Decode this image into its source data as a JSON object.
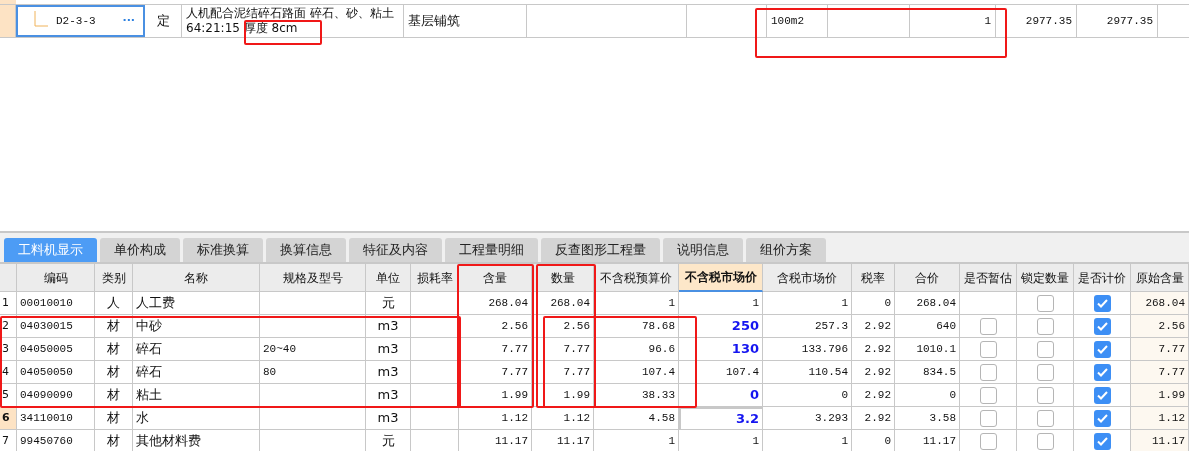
{
  "item_row": {
    "code": "D2-3-3",
    "more": "···",
    "type": "定",
    "name": "人机配合泥结碎石路面 碎石、砂、粘土64:21:15 厚度 8cm",
    "feature": "基层铺筑",
    "unit": "100m2",
    "quantity": "1",
    "unit_price": "2977.35",
    "total": "2977.35"
  },
  "tabs": [
    {
      "label": "工料机显示",
      "selected": true
    },
    {
      "label": "单价构成",
      "selected": false
    },
    {
      "label": "标准换算",
      "selected": false
    },
    {
      "label": "换算信息",
      "selected": false
    },
    {
      "label": "特征及内容",
      "selected": false
    },
    {
      "label": "工程量明细",
      "selected": false
    },
    {
      "label": "反查图形工程量",
      "selected": false
    },
    {
      "label": "说明信息",
      "selected": false
    },
    {
      "label": "组价方案",
      "selected": false
    }
  ],
  "columns": [
    "编码",
    "类别",
    "名称",
    "规格及型号",
    "单位",
    "损耗率",
    "含量",
    "数量",
    "不含税预算价",
    "不含税市场价",
    "含税市场价",
    "税率",
    "合价",
    "是否暂估",
    "锁定数量",
    "是否计价",
    "原始含量"
  ],
  "rows": [
    {
      "no": "1",
      "code": "00010010",
      "type": "人",
      "name": "人工费",
      "spec": "",
      "unit": "元",
      "content": "268.04",
      "qty": "268.04",
      "budget": "1",
      "market": "1",
      "modified": false,
      "tax_market": "1",
      "rate": "0",
      "total": "268.04",
      "locked": false,
      "priced": true,
      "original": "268.04",
      "selected": false
    },
    {
      "no": "2",
      "code": "04030015",
      "type": "材",
      "name": "中砂",
      "spec": "",
      "unit": "m3",
      "content": "2.56",
      "qty": "2.56",
      "budget": "78.68",
      "market": "250",
      "modified": true,
      "tax_market": "257.3",
      "rate": "2.92",
      "total": "640",
      "provisional": false,
      "locked": false,
      "priced": true,
      "original": "2.56",
      "selected": false
    },
    {
      "no": "3",
      "code": "04050005",
      "type": "材",
      "name": "碎石",
      "spec": "20~40",
      "unit": "m3",
      "content": "7.77",
      "qty": "7.77",
      "budget": "96.6",
      "market": "130",
      "modified": true,
      "tax_market": "133.796",
      "rate": "2.92",
      "total": "1010.1",
      "provisional": false,
      "locked": false,
      "priced": true,
      "original": "7.77",
      "selected": false
    },
    {
      "no": "4",
      "code": "04050050",
      "type": "材",
      "name": "碎石",
      "spec": "80",
      "unit": "m3",
      "content": "7.77",
      "qty": "7.77",
      "budget": "107.4",
      "market": "107.4",
      "modified": false,
      "tax_market": "110.54",
      "rate": "2.92",
      "total": "834.5",
      "provisional": false,
      "locked": false,
      "priced": true,
      "original": "7.77",
      "selected": false
    },
    {
      "no": "5",
      "code": "04090090",
      "type": "材",
      "name": "粘土",
      "spec": "",
      "unit": "m3",
      "content": "1.99",
      "qty": "1.99",
      "budget": "38.33",
      "market": "0",
      "modified": true,
      "tax_market": "0",
      "rate": "2.92",
      "total": "0",
      "provisional": false,
      "locked": false,
      "priced": true,
      "original": "1.99",
      "selected": false
    },
    {
      "no": "6",
      "code": "34110010",
      "type": "材",
      "name": "水",
      "spec": "",
      "unit": "m3",
      "content": "1.12",
      "qty": "1.12",
      "budget": "4.58",
      "market": "3.2",
      "modified": true,
      "tax_market": "3.293",
      "rate": "2.92",
      "total": "3.58",
      "provisional": false,
      "locked": false,
      "priced": true,
      "original": "1.12",
      "selected": true
    },
    {
      "no": "7",
      "code": "99450760",
      "type": "材",
      "name": "其他材料费",
      "spec": "",
      "unit": "元",
      "content": "11.17",
      "qty": "11.17",
      "budget": "1",
      "market": "1",
      "modified": false,
      "tax_market": "1",
      "rate": "0",
      "total": "11.17",
      "provisional": false,
      "locked": false,
      "priced": true,
      "original": "11.17",
      "selected": false
    }
  ]
}
